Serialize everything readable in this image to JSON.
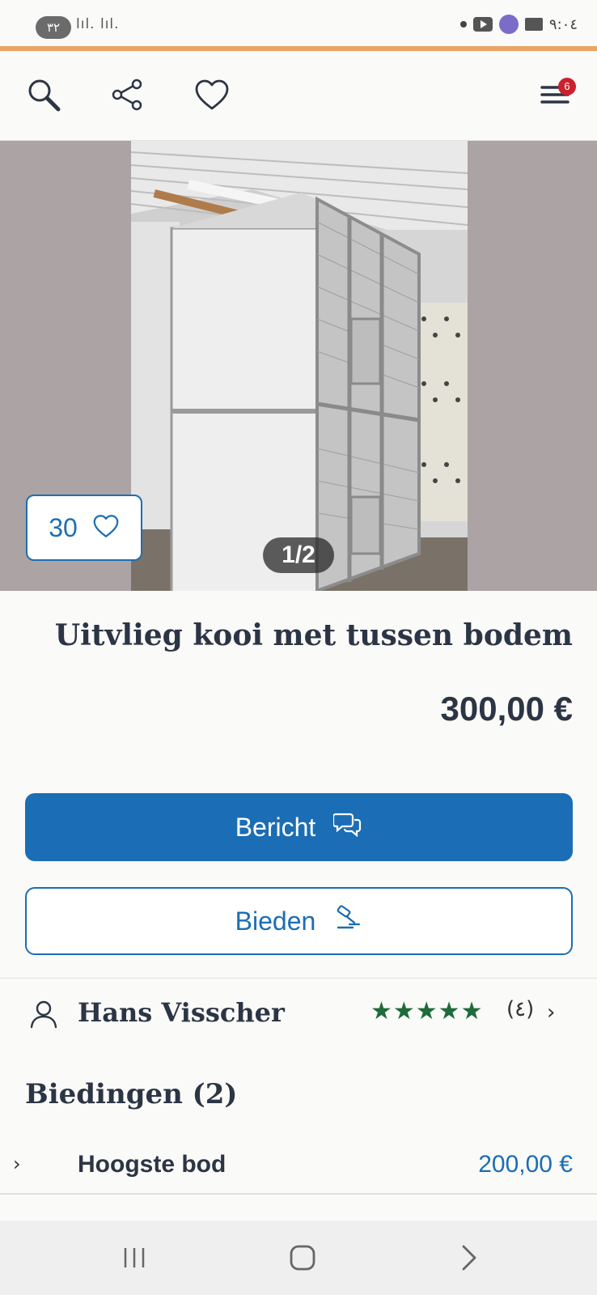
{
  "status_bar": {
    "pill": "٣٢",
    "signals": "lıl. lıl.",
    "time": "٩:٠٤"
  },
  "header": {
    "menu_badge": "6",
    "icons": [
      "search-icon",
      "share-icon",
      "heart-icon",
      "menu-icon"
    ]
  },
  "gallery": {
    "favorites_count": "30",
    "pager": "1/2"
  },
  "listing": {
    "title": "Uitvlieg kooi met tussen bodem",
    "price": "300,00 €"
  },
  "buttons": {
    "message_label": "Bericht",
    "bid_label": "Bieden"
  },
  "seller": {
    "name": "Hans Visscher",
    "stars": "★★★★★",
    "rating": 5,
    "review_count": "(٤)"
  },
  "bids": {
    "title": "Biedingen (2)",
    "highest_label": "Hoogste bod",
    "highest_value": "200,00 €"
  },
  "colors": {
    "accent_orange": "#eba463",
    "primary_blue": "#1b6db5",
    "star_green": "#1f6b3a",
    "badge_red": "#c9222e",
    "text_dark": "#2b3545"
  }
}
